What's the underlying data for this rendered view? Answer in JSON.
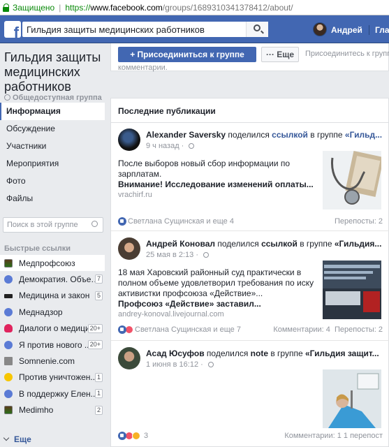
{
  "browser": {
    "secure_label": "Защищено",
    "url_scheme": "https://",
    "url_host": "www.facebook.com",
    "url_path": "/groups/1689310341378412/about/"
  },
  "topbar": {
    "search_value": "Гильдия защиты медицинских работников",
    "user_name": "Андрей",
    "home_label": "Главна"
  },
  "group": {
    "name": "Гильдия защиты медицинских работников",
    "type": "Общедоступная группа"
  },
  "nav": [
    {
      "label": "Информация",
      "active": true
    },
    {
      "label": "Обсуждение"
    },
    {
      "label": "Участники"
    },
    {
      "label": "Мероприятия"
    },
    {
      "label": "Фото"
    },
    {
      "label": "Файлы"
    }
  ],
  "group_search_placeholder": "Поиск в этой группе",
  "quick_links": {
    "title": "Быстрые ссылки",
    "items": [
      {
        "label": "Медпрофсоюз",
        "icon": "image",
        "badge": ""
      },
      {
        "label": "Демократия. Объед...",
        "icon": "group",
        "badge": "7"
      },
      {
        "label": "Медицина и закон",
        "icon": "mortarboard",
        "badge": "5"
      },
      {
        "label": "Меднадзор",
        "icon": "group",
        "badge": ""
      },
      {
        "label": "Диалоги о медици...",
        "icon": "broken-heart",
        "badge": "20+"
      },
      {
        "label": "Я против нового ...",
        "icon": "group",
        "badge": "20+"
      },
      {
        "label": "Somnenie.com",
        "icon": "square",
        "badge": ""
      },
      {
        "label": "Против уничтожен...",
        "icon": "bulb",
        "badge": "1"
      },
      {
        "label": "В поддержку Елен...",
        "icon": "group",
        "badge": "1"
      },
      {
        "label": "Medimho",
        "icon": "image",
        "badge": "2"
      }
    ],
    "more_label": "Еще"
  },
  "topcard": {
    "join_label": "+ Присоединиться к группе",
    "more_label": "··· Еще",
    "join_note": "Присоединитесь к группе",
    "comments_note": "комментарии."
  },
  "feed": {
    "title": "Последние публикации",
    "posts": [
      {
        "author": "Alexander Saversky",
        "shared": "поделился",
        "link_word": "ссылкой",
        "in_group": "в группе",
        "group_short": "«Гильд...",
        "time": "9 ч назад",
        "text": "После выборов новый сбор информации по зарплатам.",
        "link_title": "Внимание! Исследование изменений оплаты...",
        "link_domain": "vrachirf.ru",
        "reactions": "Светлана Сущинская и еще 4",
        "comments": "",
        "shares": "Перепосты: 2"
      },
      {
        "author": "Андрей Коновал",
        "shared": "поделился",
        "link_word": "ссылкой",
        "in_group": "в группе",
        "group_short": "«Гильдия...",
        "time": "25 мая в 2:13",
        "text": "18 мая Харовский районный суд практически в полном объеме удовлетворил требования по иску активистки профсоюза «Действие»...",
        "link_title": "Профсоюз «Действие» заставил...",
        "link_domain": "andrey-konoval.livejournal.com",
        "reactions": "Светлана Сущинская и еще 7",
        "comments": "Комментарии: 4",
        "shares": "Перепосты: 2"
      },
      {
        "author": "Асад Юсуфов",
        "shared": "поделился",
        "link_word": "note",
        "in_group": "в группе",
        "group_short": "«Гильдия защит...",
        "time": "1 июня в 16:12",
        "reactions": "3",
        "comments": "Комментарии: 1",
        "shares": "1 перепост"
      }
    ]
  },
  "colors": {
    "fb_blue": "#4267b2",
    "link_blue": "#365899",
    "secure_green": "#0a8a0a",
    "page_bg": "#e9ebee"
  }
}
